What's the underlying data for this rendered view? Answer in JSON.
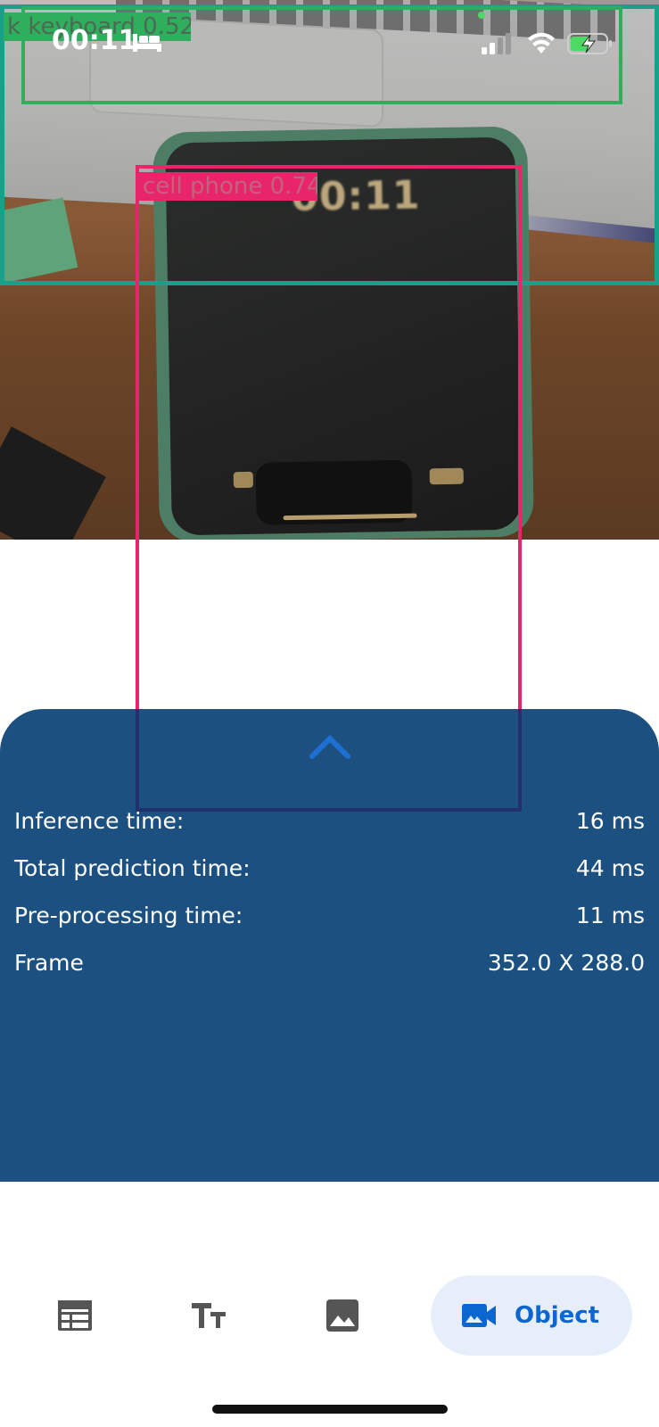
{
  "status_bar": {
    "time": "00:11",
    "icons": [
      "bed-icon",
      "signal-icon",
      "wifi-icon",
      "battery-charging-icon"
    ]
  },
  "camera_view": {
    "phone_clock_text": "00:11",
    "detections": [
      {
        "label": "keyboard",
        "score": "0.52",
        "text": "k keyboard 0.52",
        "color": "#2fae5e"
      },
      {
        "label": "cell phone",
        "score": "0.74",
        "text": "cell phone 0.74",
        "color": "#e8256a"
      }
    ],
    "frame_outline_color": "#18a08a"
  },
  "info_panel": {
    "background": "#1c5080",
    "expand_icon": "chevron-up-icon",
    "rows": [
      {
        "label": "Inference time:",
        "value": "16 ms"
      },
      {
        "label": "Total prediction time:",
        "value": "44 ms"
      },
      {
        "label": "Pre-processing time:",
        "value": "11 ms"
      },
      {
        "label": "Frame",
        "value": "352.0 X 288.0"
      }
    ]
  },
  "bottom_nav": {
    "items": [
      {
        "icon": "table-icon",
        "label": "",
        "active": false
      },
      {
        "icon": "text-size-icon",
        "label": "",
        "active": false
      },
      {
        "icon": "image-icon",
        "label": "",
        "active": false
      },
      {
        "icon": "video-camera-icon",
        "label": "Object",
        "active": true
      }
    ],
    "active_color": "#0b67cf",
    "active_bg": "#e5eef9",
    "inactive_color": "#555555"
  }
}
